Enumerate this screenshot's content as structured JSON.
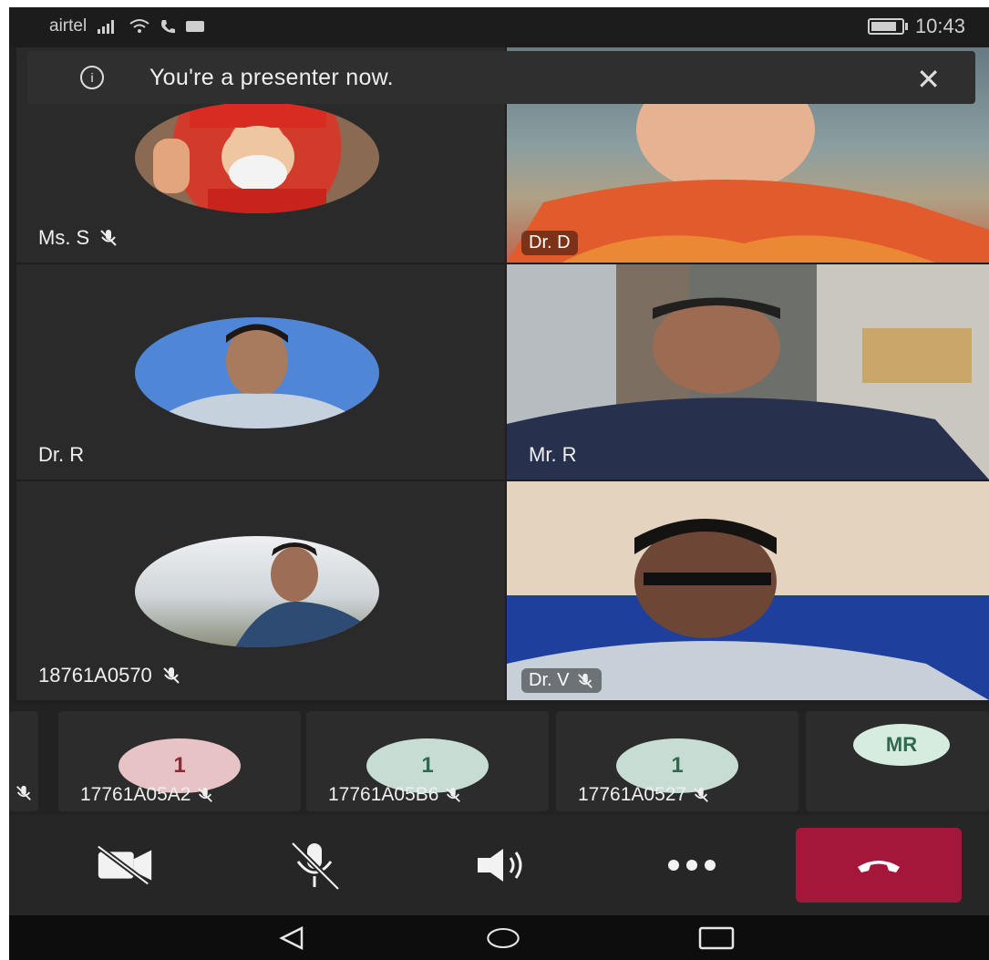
{
  "status_bar": {
    "carrier": "airtel",
    "time": "10:43",
    "icons": [
      "signal-icon",
      "wifi-icon",
      "call-icon",
      "data-icon",
      "battery-icon"
    ]
  },
  "toast": {
    "message": "You're a presenter now.",
    "icon": "info-icon",
    "close_icon": "close-icon"
  },
  "participants": [
    {
      "name": "Ms. S",
      "muted": true,
      "type": "avatar"
    },
    {
      "name": "Dr. D",
      "muted": false,
      "type": "video"
    },
    {
      "name": "Dr. R",
      "muted": false,
      "type": "avatar"
    },
    {
      "name": "Mr. R",
      "muted": false,
      "type": "video"
    },
    {
      "name": "18761A0570",
      "muted": true,
      "type": "avatar"
    },
    {
      "name": "Dr. V",
      "muted": true,
      "type": "video"
    }
  ],
  "strip": [
    {
      "badge": "1",
      "name": "17761A05A2",
      "muted": true,
      "color": "#e7c3c6",
      "text_color": "#8a2a3a"
    },
    {
      "badge": "1",
      "name": "17761A05B6",
      "muted": true,
      "color": "#c7ddd3",
      "text_color": "#2f6a50"
    },
    {
      "badge": "1",
      "name": "17761A0527",
      "muted": true,
      "color": "#c7ddd3",
      "text_color": "#2f6a50"
    },
    {
      "badge": "MR",
      "name": "",
      "muted": false,
      "color": "#d6ecdf",
      "text_color": "#2f6a50"
    }
  ],
  "controls": [
    "camera-off-icon",
    "mic-off-icon",
    "speaker-icon",
    "more-icon",
    "hang-up-icon"
  ],
  "colors": {
    "hangup": "#a4173a",
    "background": "#1f1f1f"
  }
}
